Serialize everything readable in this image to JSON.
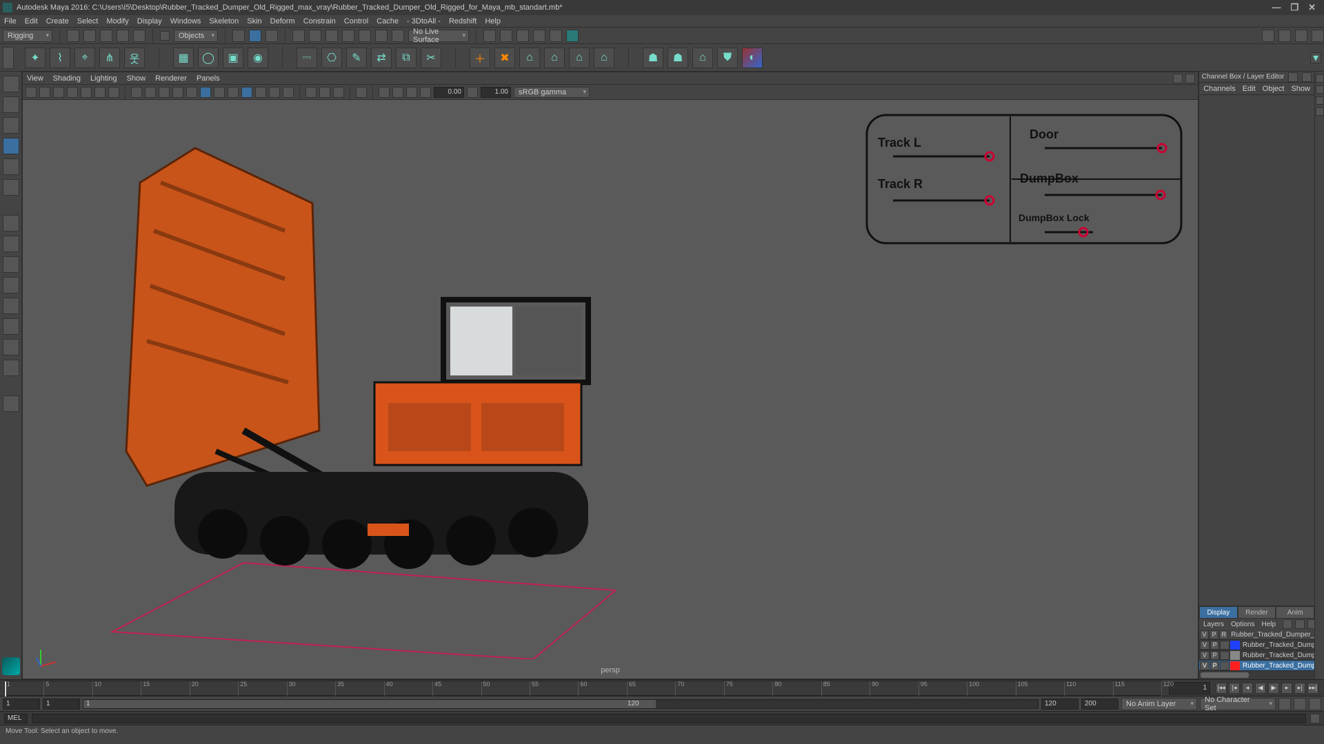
{
  "app": {
    "title": "Autodesk Maya 2016: C:\\Users\\I5\\Desktop\\Rubber_Tracked_Dumper_Old_Rigged_max_vray\\Rubber_Tracked_Dumper_Old_Rigged_for_Maya_mb_standart.mb*",
    "minimize": "—",
    "maximize": "❐",
    "close": "✕"
  },
  "menus": [
    "File",
    "Edit",
    "Create",
    "Select",
    "Modify",
    "Display",
    "Windows",
    "Skeleton",
    "Skin",
    "Deform",
    "Constrain",
    "Control",
    "Cache",
    "- 3DtoAll -",
    "Redshift",
    "Help"
  ],
  "topshelf": {
    "workspace": "Rigging",
    "mask_mode": "Objects",
    "live_surface": "No Live Surface"
  },
  "viewport_menu": [
    "View",
    "Shading",
    "Lighting",
    "Show",
    "Renderer",
    "Panels"
  ],
  "viewport_toolbar": {
    "val1": "0.00",
    "val2": "1.00",
    "colorspace": "sRGB gamma"
  },
  "viewport": {
    "camera": "persp",
    "axes": [
      "x",
      "y",
      "z"
    ]
  },
  "rig_controls": {
    "track_l": "Track L",
    "track_r": "Track R",
    "door": "Door",
    "dumpbox": "DumpBox",
    "dumpbox_lock": "DumpBox Lock"
  },
  "channelbox": {
    "header": "Channel Box / Layer Editor",
    "tabs": [
      "Channels",
      "Edit",
      "Object",
      "Show"
    ]
  },
  "layer_editor": {
    "tabs": [
      "Display",
      "Render",
      "Anim"
    ],
    "active_tab": "Display",
    "menu": [
      "Layers",
      "Options",
      "Help"
    ],
    "hdr_v": "V",
    "hdr_p": "P",
    "hdr_r": "R",
    "rows": [
      {
        "v": "V",
        "p": "P",
        "r": "R",
        "color": "#888888",
        "name": "Rubber_Tracked_Dumper_Ol",
        "sel": false
      },
      {
        "v": "V",
        "p": "P",
        "r": "",
        "color": "#2040ff",
        "name": "Rubber_Tracked_Dump",
        "sel": false
      },
      {
        "v": "V",
        "p": "P",
        "r": "",
        "color": "#888888",
        "name": "Rubber_Tracked_Dump",
        "sel": false
      },
      {
        "v": "V",
        "p": "P",
        "r": "",
        "color": "#ff2020",
        "name": "Rubber_Tracked_Dump",
        "sel": true
      }
    ]
  },
  "timeline": {
    "start_frame": "1",
    "ticks": [
      1,
      5,
      10,
      15,
      20,
      25,
      30,
      35,
      40,
      45,
      50,
      55,
      60,
      65,
      70,
      75,
      80,
      85,
      90,
      95,
      100,
      105,
      110,
      115,
      120
    ],
    "current": "1"
  },
  "range": {
    "start": "1",
    "inner_start": "1",
    "inner_end": "120",
    "end_a": "120",
    "end_b": "200",
    "anim_layer": "No Anim Layer",
    "char_set": "No Character Set"
  },
  "cmd": {
    "lang": "MEL",
    "input": ""
  },
  "helpline": "Move Tool: Select an object to move."
}
